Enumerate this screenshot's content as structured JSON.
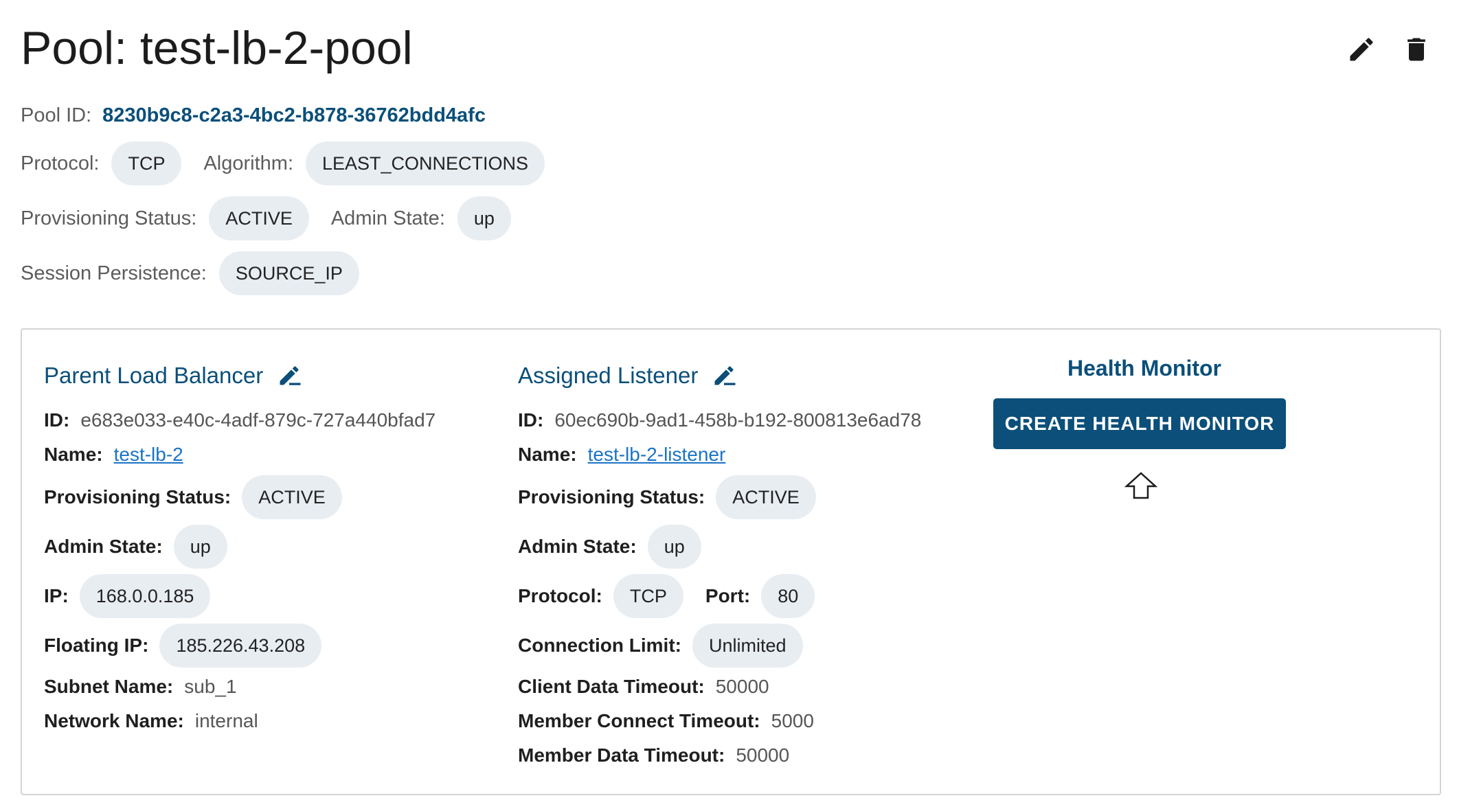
{
  "header": {
    "title": "Pool: test-lb-2-pool"
  },
  "icons": {
    "edit": "pencil-icon",
    "delete": "trash-icon",
    "section_edit": "pencil-edit-icon",
    "pointer": "arrow-up-icon"
  },
  "colors": {
    "accent": "#0b4f7a",
    "chip_bg": "#e8edf2",
    "link": "#1a73c6"
  },
  "pool": {
    "id_label": "Pool ID:",
    "id": "8230b9c8-c2a3-4bc2-b878-36762bdd4afc",
    "protocol_label": "Protocol:",
    "protocol": "TCP",
    "algorithm_label": "Algorithm:",
    "algorithm": "LEAST_CONNECTIONS",
    "provisioning_label": "Provisioning Status:",
    "provisioning": "ACTIVE",
    "admin_label": "Admin State:",
    "admin": "up",
    "session_label": "Session Persistence:",
    "session": "SOURCE_IP"
  },
  "load_balancer": {
    "title": "Parent Load Balancer",
    "id_label": "ID:",
    "id": "e683e033-e40c-4adf-879c-727a440bfad7",
    "name_label": "Name:",
    "name": "test-lb-2",
    "provisioning_label": "Provisioning Status:",
    "provisioning": "ACTIVE",
    "admin_label": "Admin State:",
    "admin": "up",
    "ip_label": "IP:",
    "ip": "168.0.0.185",
    "floating_label": "Floating IP:",
    "floating": "185.226.43.208",
    "subnet_label": "Subnet Name:",
    "subnet": "sub_1",
    "network_label": "Network Name:",
    "network": "internal"
  },
  "listener": {
    "title": "Assigned Listener",
    "id_label": "ID:",
    "id": "60ec690b-9ad1-458b-b192-800813e6ad78",
    "name_label": "Name:",
    "name": "test-lb-2-listener",
    "provisioning_label": "Provisioning Status:",
    "provisioning": "ACTIVE",
    "admin_label": "Admin State:",
    "admin": "up",
    "protocol_label": "Protocol:",
    "protocol": "TCP",
    "port_label": "Port:",
    "port": "80",
    "conn_limit_label": "Connection Limit:",
    "conn_limit": "Unlimited",
    "client_timeout_label": "Client Data Timeout:",
    "client_timeout": "50000",
    "member_connect_label": "Member Connect Timeout:",
    "member_connect": "5000",
    "member_data_label": "Member Data Timeout:",
    "member_data": "50000"
  },
  "health_monitor": {
    "title": "Health Monitor",
    "create_button": "CREATE HEALTH MONITOR"
  }
}
